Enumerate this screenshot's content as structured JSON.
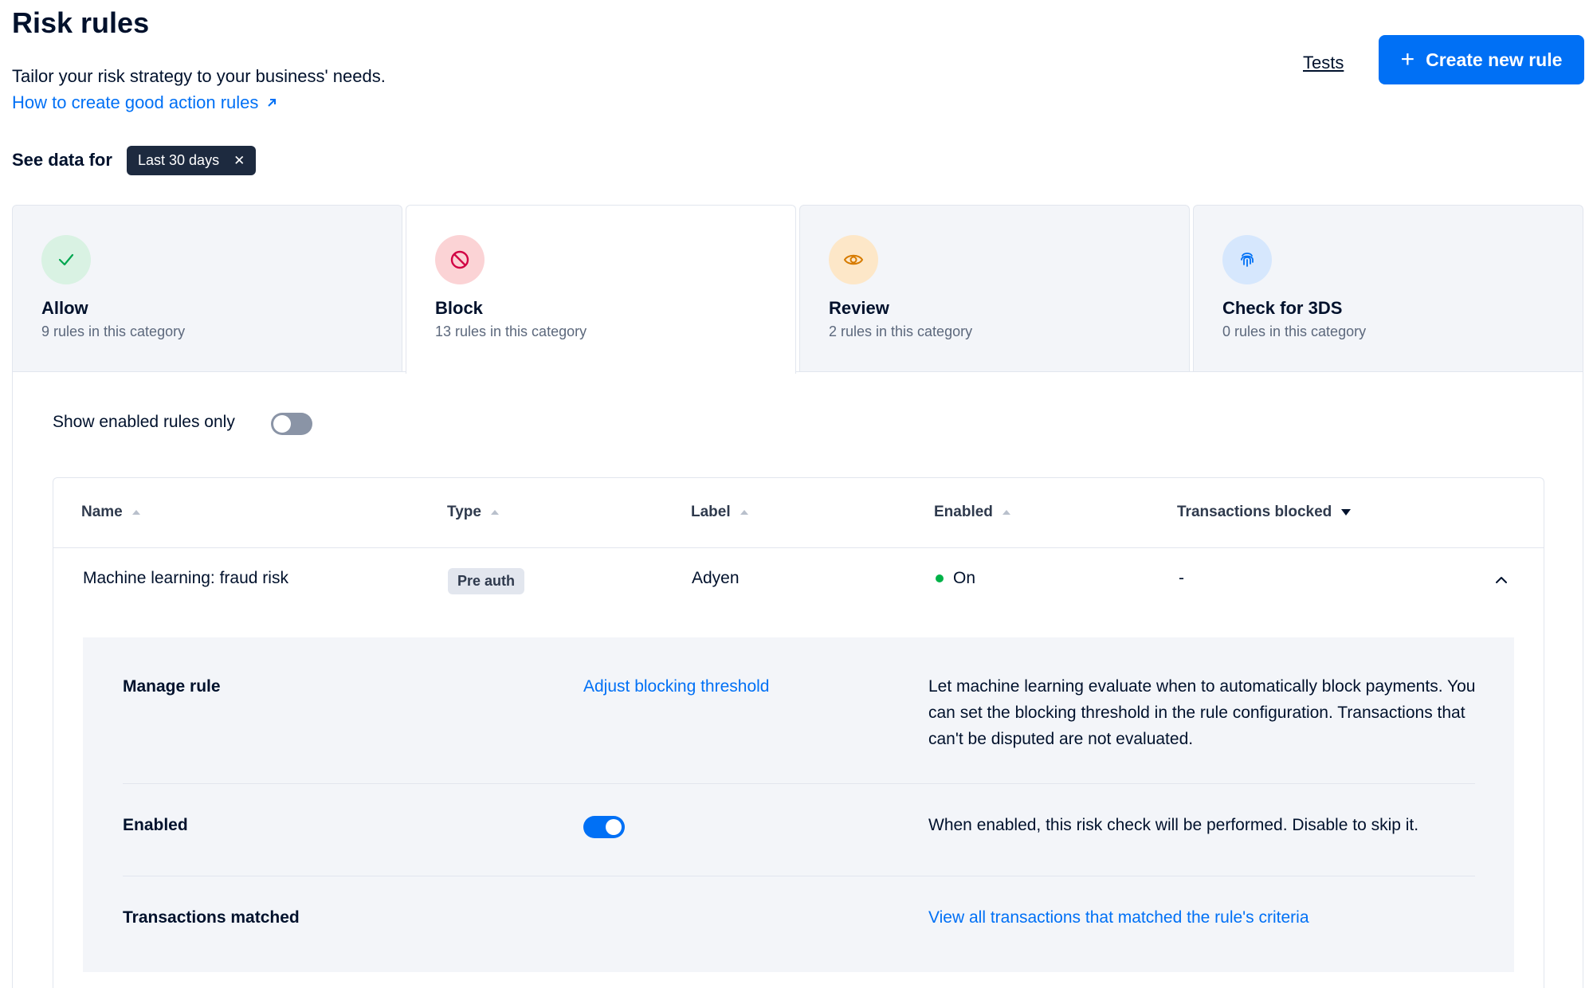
{
  "header": {
    "title": "Risk rules",
    "subtitle": "Tailor your risk strategy to your business' needs.",
    "help_link": "How to create good action rules",
    "tests_link": "Tests",
    "create_button": "Create new rule"
  },
  "filter": {
    "label": "See data for",
    "chip": "Last 30 days"
  },
  "categories": [
    {
      "title": "Allow",
      "subtitle": "9 rules in this category",
      "icon": "check-icon",
      "color": "#00a64f",
      "bg": "#d9f2e3"
    },
    {
      "title": "Block",
      "subtitle": "13 rules in this category",
      "icon": "block-icon",
      "color": "#d10244",
      "bg": "#fbd3d5"
    },
    {
      "title": "Review",
      "subtitle": "2 rules in this category",
      "icon": "eye-icon",
      "color": "#d77b00",
      "bg": "#fde7c8"
    },
    {
      "title": "Check for 3DS",
      "subtitle": "0 rules in this category",
      "icon": "fingerprint-icon",
      "color": "#0070f5",
      "bg": "#d6e7fd"
    }
  ],
  "active_category": "Block",
  "toggle": {
    "label": "Show enabled rules only",
    "enabled": false
  },
  "table": {
    "columns": [
      "Name",
      "Type",
      "Label",
      "Enabled",
      "Transactions blocked"
    ],
    "rows": [
      {
        "name": "Machine learning: fraud risk",
        "type": "Pre auth",
        "label": "Adyen",
        "enabled": "On",
        "transactions_blocked": "-"
      }
    ]
  },
  "details": {
    "manage_label": "Manage rule",
    "manage_link": "Adjust blocking threshold",
    "manage_desc": "Let machine learning evaluate when to automatically block payments. You can set the blocking threshold in the rule configuration. Transactions that can't be disputed are not evaluated.",
    "enabled_label": "Enabled",
    "enabled_desc": "When enabled, this risk check will be performed. Disable to skip it.",
    "matched_label": "Transactions matched",
    "matched_link": "View all transactions that matched the rule's criteria"
  }
}
